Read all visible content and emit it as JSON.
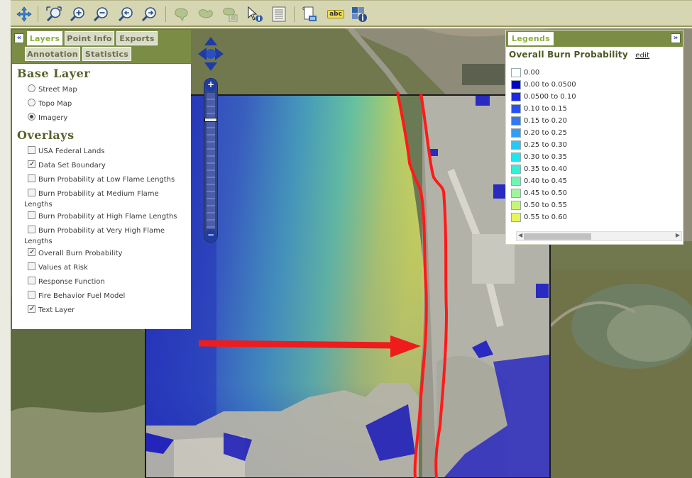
{
  "toolbar": {
    "buttons": [
      "pan-icon",
      "zoom-extent-icon",
      "zoom-in-icon",
      "zoom-out-icon",
      "zoom-previous-icon",
      "zoom-next-icon",
      "select-polygon-icon",
      "select-lasso-icon",
      "clear-selection-icon",
      "identify-icon",
      "attribute-table-icon",
      "print-icon",
      "label-text-icon",
      "map-info-icon"
    ],
    "label_text": "abc"
  },
  "layers_panel": {
    "tabs": [
      {
        "label": "Layers",
        "active": true
      },
      {
        "label": "Point Info"
      },
      {
        "label": "Exports"
      },
      {
        "label": "Annotation"
      },
      {
        "label": "Statistics"
      }
    ],
    "collapse_glyph": "«",
    "base_layer_title": "Base Layer",
    "base_layers": [
      {
        "label": "Street Map",
        "checked": false
      },
      {
        "label": "Topo Map",
        "checked": false
      },
      {
        "label": "Imagery",
        "checked": true
      }
    ],
    "overlays_title": "Overlays",
    "overlays": [
      {
        "label": "USA Federal Lands",
        "checked": false
      },
      {
        "label": "Data Set Boundary",
        "checked": true
      },
      {
        "label": "Burn Probability at Low Flame Lengths",
        "checked": false
      },
      {
        "label": "Burn Probability at Medium Flame Lengths",
        "checked": false
      },
      {
        "label": "Burn Probability at High Flame Lengths",
        "checked": false
      },
      {
        "label": "Burn Probability at Very High Flame Lengths",
        "checked": false
      },
      {
        "label": "Overall Burn Probability",
        "checked": true
      },
      {
        "label": "Values at Risk",
        "checked": false
      },
      {
        "label": "Response Function",
        "checked": false
      },
      {
        "label": "Fire Behavior Fuel Model",
        "checked": false
      },
      {
        "label": "Text Layer",
        "checked": true
      }
    ]
  },
  "legend": {
    "tab_label": "Legends",
    "expand_glyph": "»",
    "title": "Overall Burn Probability",
    "edit_link": "edit",
    "items": [
      {
        "label": "0.00",
        "color": "#ffffff"
      },
      {
        "label": "0.00 to 0.0500",
        "color": "#0000c8"
      },
      {
        "label": "0.0500 to 0.10",
        "color": "#1e28e6"
      },
      {
        "label": "0.10 to 0.15",
        "color": "#2850f0"
      },
      {
        "label": "0.15 to 0.20",
        "color": "#3278f0"
      },
      {
        "label": "0.20 to 0.25",
        "color": "#329ff5"
      },
      {
        "label": "0.25 to 0.30",
        "color": "#28c8f0"
      },
      {
        "label": "0.30 to 0.35",
        "color": "#1ee6f0"
      },
      {
        "label": "0.35 to 0.40",
        "color": "#32f0d2"
      },
      {
        "label": "0.40 to 0.45",
        "color": "#6ef5b4"
      },
      {
        "label": "0.45 to 0.50",
        "color": "#a0f59b"
      },
      {
        "label": "0.50 to 0.55",
        "color": "#c8f578"
      },
      {
        "label": "0.55 to 0.60",
        "color": "#e6f55a"
      }
    ]
  },
  "map": {
    "zoom_in": "+",
    "zoom_out": "−",
    "boundary_color": "#ff1a1a",
    "arrow_color": "#ee1c1c"
  }
}
